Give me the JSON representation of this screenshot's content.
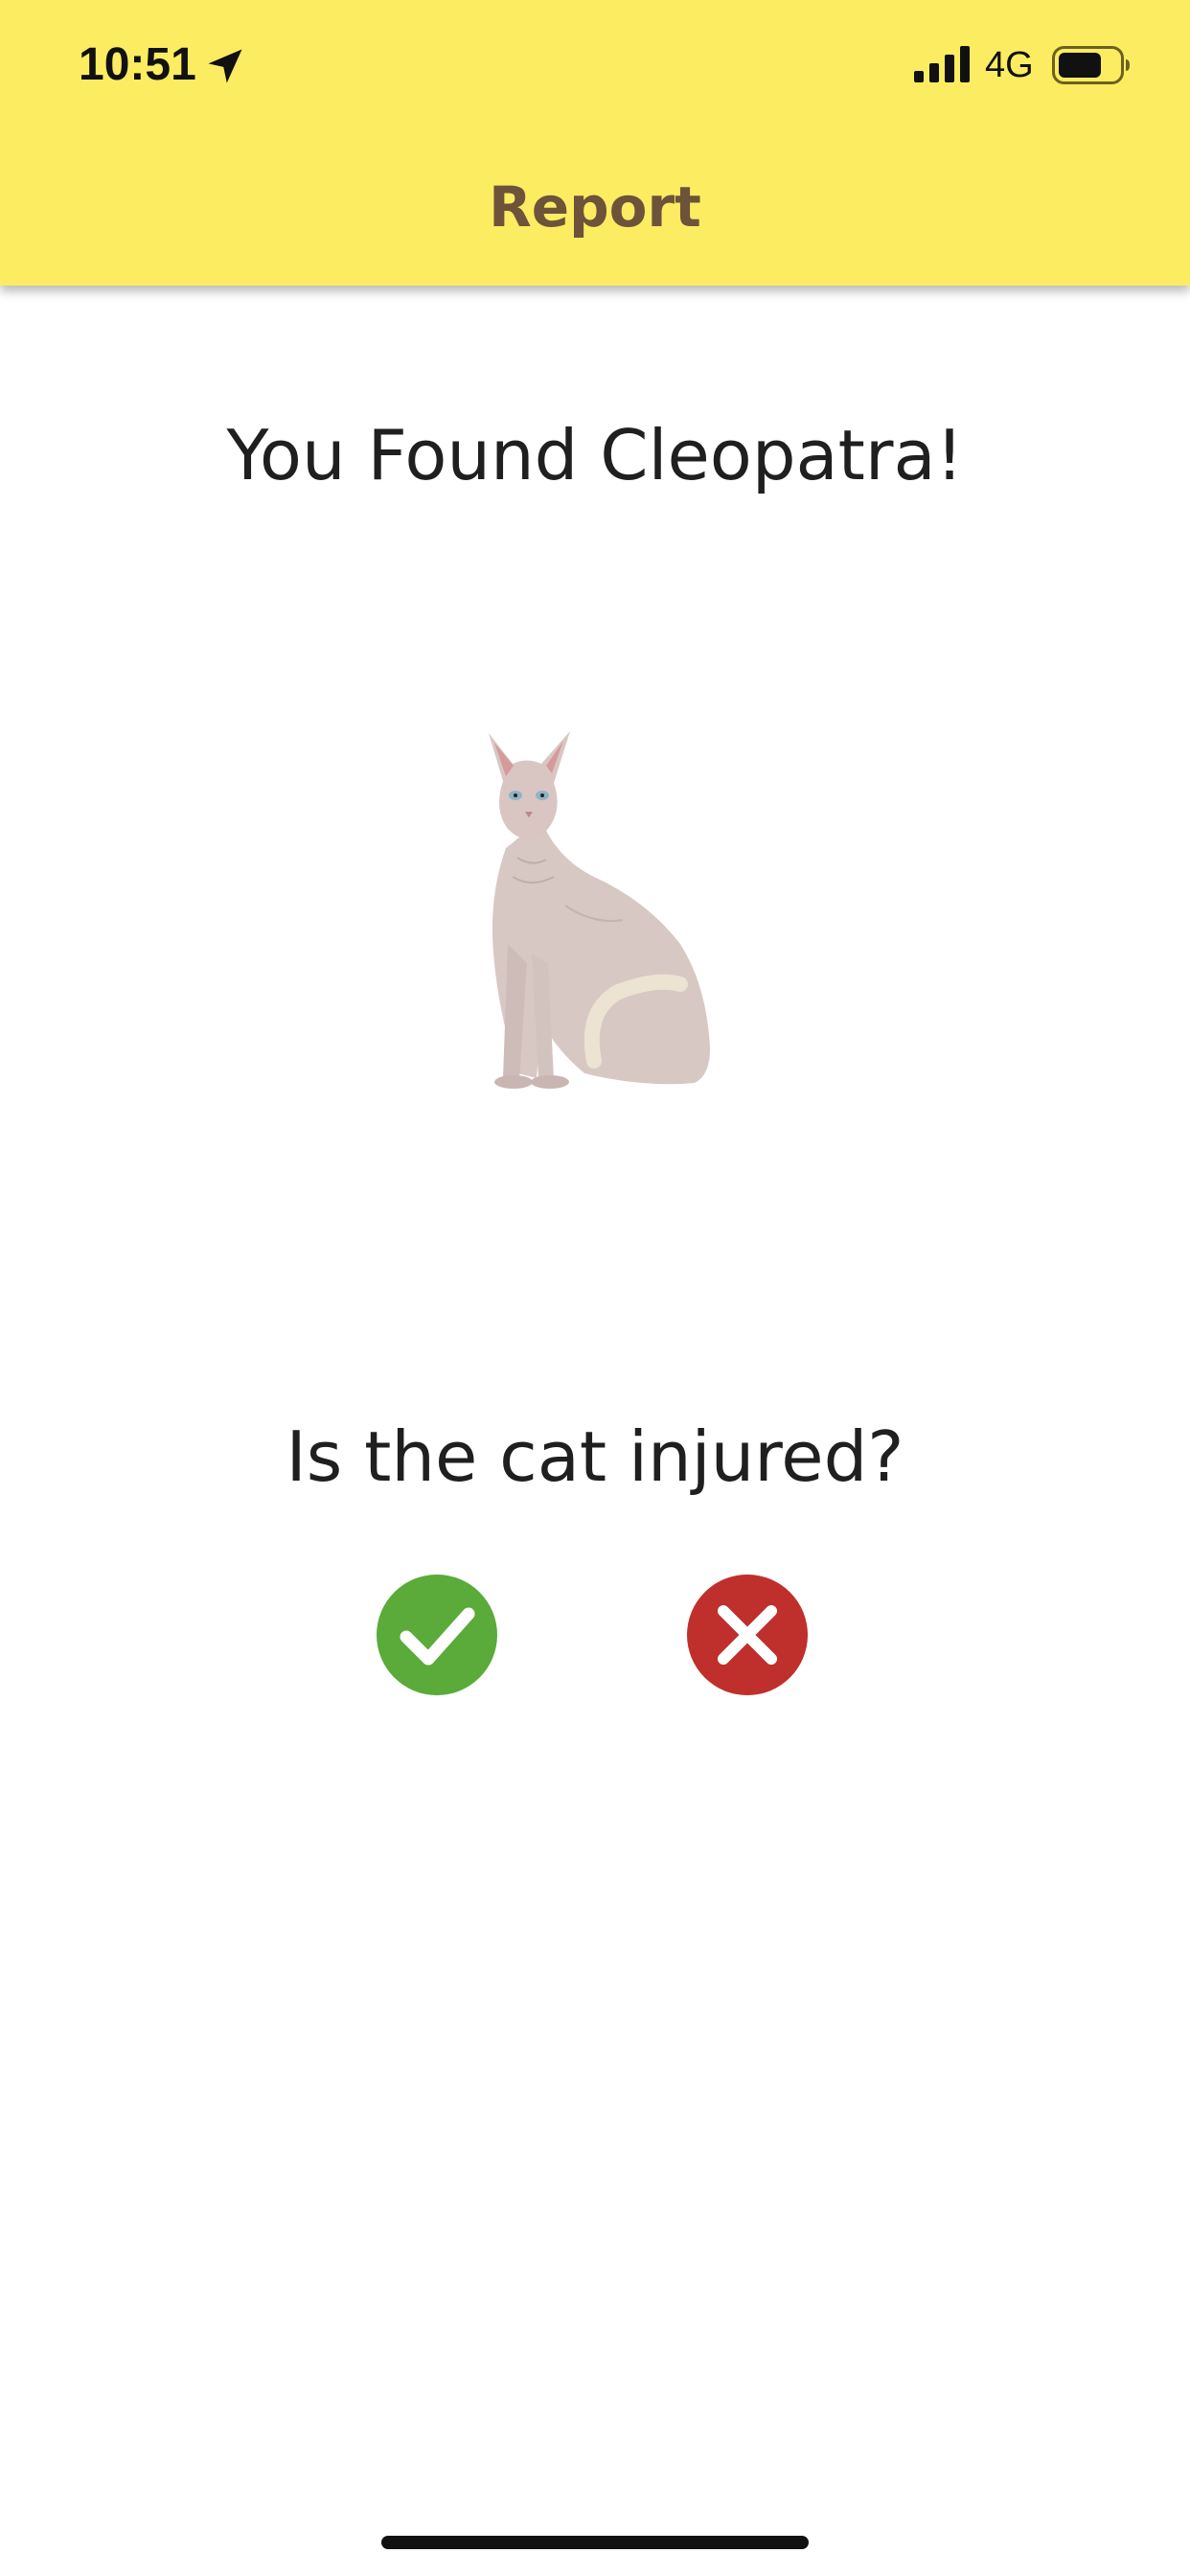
{
  "status_bar": {
    "time": "10:51",
    "network": "4G",
    "icons": [
      "location-arrow-icon",
      "cellular-signal-icon",
      "battery-icon"
    ]
  },
  "nav": {
    "title": "Report"
  },
  "main": {
    "found_title": "You Found Cleopatra!",
    "image_subject": "sphynx-cat",
    "question": "Is the cat injured?",
    "yes_icon": "checkmark-icon",
    "no_icon": "close-icon"
  },
  "colors": {
    "header_bg": "#fcec62",
    "title_color": "#6d5339",
    "yes_green": "#5aab39",
    "no_red": "#bf2f2c",
    "text": "#1f1f1f"
  }
}
